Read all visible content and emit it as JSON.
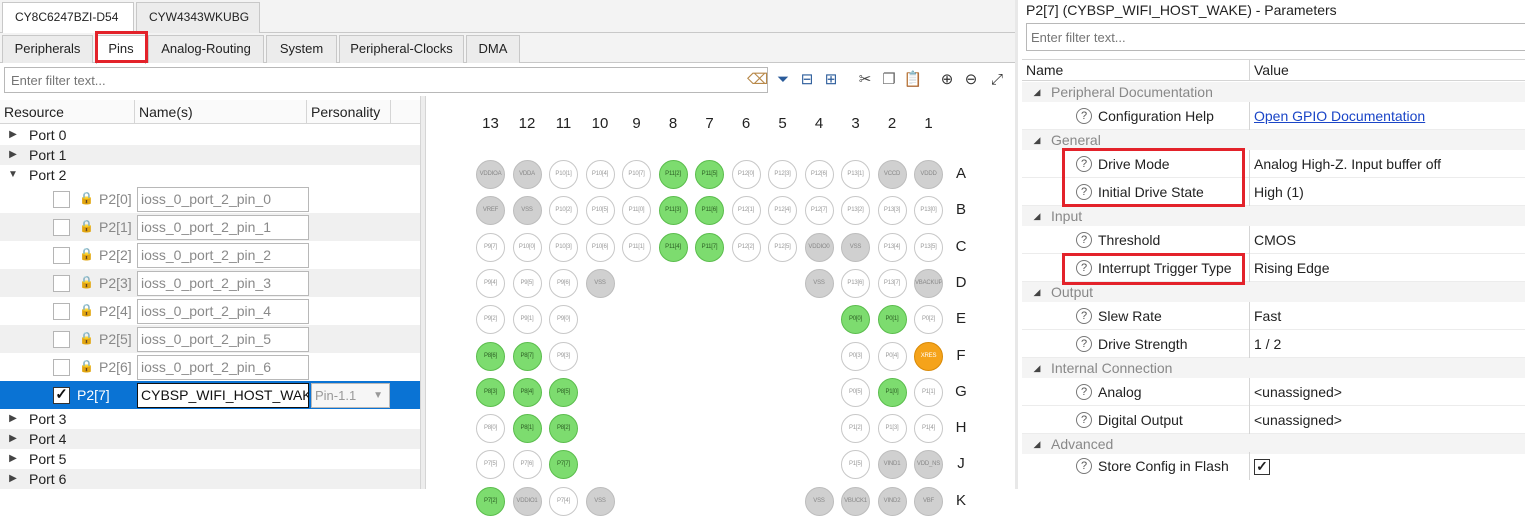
{
  "device_tabs": [
    "CY8C6247BZI-D54",
    "CYW4343WKUBG"
  ],
  "sub_tabs": [
    "Peripherals",
    "Pins",
    "Analog-Routing",
    "System",
    "Peripheral-Clocks",
    "DMA"
  ],
  "filter_placeholder": "Enter filter text...",
  "resource_table": {
    "headers": [
      "Resource",
      "Name(s)",
      "Personality"
    ],
    "ports_top": [
      "Port 0",
      "Port 1",
      "Port 2"
    ],
    "pins": [
      {
        "label": "P2[0]",
        "name": "ioss_0_port_2_pin_0"
      },
      {
        "label": "P2[1]",
        "name": "ioss_0_port_2_pin_1"
      },
      {
        "label": "P2[2]",
        "name": "ioss_0_port_2_pin_2"
      },
      {
        "label": "P2[3]",
        "name": "ioss_0_port_2_pin_3"
      },
      {
        "label": "P2[4]",
        "name": "ioss_0_port_2_pin_4"
      },
      {
        "label": "P2[5]",
        "name": "ioss_0_port_2_pin_5"
      },
      {
        "label": "P2[6]",
        "name": "ioss_0_port_2_pin_6"
      },
      {
        "label": "P2[7]",
        "name": "CYBSP_WIFI_HOST_WAKE",
        "personality": "Pin-1.1"
      }
    ],
    "ports_bottom": [
      "Port 3",
      "Port 4",
      "Port 5",
      "Port 6"
    ]
  },
  "pin_grid": {
    "columns": [
      "13",
      "12",
      "11",
      "10",
      "9",
      "8",
      "7",
      "6",
      "5",
      "4",
      "3",
      "2",
      "1"
    ],
    "rows": [
      "A",
      "B",
      "C",
      "D",
      "E",
      "F",
      "G",
      "H",
      "J",
      "K"
    ],
    "pins": [
      [
        "VDDIOA",
        "VDDA",
        "P10[1]",
        "P10[4]",
        "P10[7]",
        "P11[2]",
        "P11[5]",
        "P12[0]",
        "P12[3]",
        "P12[6]",
        "P13[1]",
        "VCCD",
        "VDDD"
      ],
      [
        "VREF",
        "VSS",
        "P10[2]",
        "P10[5]",
        "P11[0]",
        "P11[3]",
        "P11[6]",
        "P12[1]",
        "P12[4]",
        "P12[7]",
        "P13[2]",
        "P13[3]",
        "P13[0]"
      ],
      [
        "P9[7]",
        "P10[0]",
        "P10[3]",
        "P10[6]",
        "P11[1]",
        "P11[4]",
        "P11[7]",
        "P12[2]",
        "P12[5]",
        "VDDIO0",
        "VSS",
        "P13[4]",
        "P13[5]"
      ],
      [
        "P9[4]",
        "P9[5]",
        "P9[6]",
        "VSS",
        "",
        "",
        "",
        "",
        "",
        "VSS",
        "P13[6]",
        "P13[7]",
        "VBACKUP"
      ],
      [
        "P9[2]",
        "P9[1]",
        "P9[0]",
        "",
        "",
        "",
        "",
        "",
        "",
        "",
        "P0[0]",
        "P0[1]",
        "P0[2]"
      ],
      [
        "P8[6]",
        "P8[7]",
        "P9[3]",
        "",
        "",
        "",
        "",
        "",
        "",
        "",
        "P0[3]",
        "P0[4]",
        "XRES"
      ],
      [
        "P8[3]",
        "P8[4]",
        "P8[5]",
        "",
        "",
        "",
        "",
        "",
        "",
        "",
        "P0[5]",
        "P1[0]",
        "P1[1]"
      ],
      [
        "P8[0]",
        "P8[1]",
        "P8[2]",
        "",
        "",
        "",
        "",
        "",
        "",
        "",
        "P1[2]",
        "P1[3]",
        "P1[4]"
      ],
      [
        "P7[5]",
        "P7[6]",
        "P7[7]",
        "",
        "",
        "",
        "",
        "",
        "",
        "",
        "P1[5]",
        "VIND1",
        "VDD_NS"
      ],
      [
        "P7[2]",
        "VDDIO1",
        "P7[4]",
        "VSS",
        "",
        "",
        "",
        "",
        "",
        "VSS",
        "VBUCK1",
        "VIND2",
        "VBF"
      ]
    ],
    "states": [
      [
        "g",
        "g",
        "w",
        "w",
        "w",
        "G",
        "G",
        "w",
        "w",
        "w",
        "w",
        "g",
        "g"
      ],
      [
        "g",
        "g",
        "w",
        "w",
        "w",
        "G",
        "G",
        "w",
        "w",
        "w",
        "w",
        "w",
        "w"
      ],
      [
        "w",
        "w",
        "w",
        "w",
        "w",
        "G",
        "G",
        "w",
        "w",
        "g",
        "g",
        "w",
        "w"
      ],
      [
        "w",
        "w",
        "w",
        "g",
        "-",
        "-",
        "-",
        "-",
        "-",
        "g",
        "w",
        "w",
        "g"
      ],
      [
        "w",
        "w",
        "w",
        "-",
        "-",
        "-",
        "-",
        "-",
        "-",
        "-",
        "G",
        "G",
        "w"
      ],
      [
        "G",
        "G",
        "w",
        "-",
        "-",
        "-",
        "-",
        "-",
        "-",
        "-",
        "w",
        "w",
        "O"
      ],
      [
        "G",
        "G",
        "G",
        "-",
        "-",
        "-",
        "-",
        "-",
        "-",
        "-",
        "w",
        "G",
        "w"
      ],
      [
        "w",
        "G",
        "G",
        "-",
        "-",
        "-",
        "-",
        "-",
        "-",
        "-",
        "w",
        "w",
        "w"
      ],
      [
        "w",
        "w",
        "G",
        "-",
        "-",
        "-",
        "-",
        "-",
        "-",
        "-",
        "w",
        "g",
        "g"
      ],
      [
        "G",
        "g",
        "w",
        "g",
        "-",
        "-",
        "-",
        "-",
        "-",
        "g",
        "g",
        "g",
        "g"
      ]
    ]
  },
  "parameters": {
    "title": "P2[7] (CYBSP_WIFI_HOST_WAKE) - Parameters",
    "filter_placeholder": "Enter filter text...",
    "col_name": "Name",
    "col_value": "Value",
    "groups": {
      "peripheral_doc": "Peripheral Documentation",
      "general": "General",
      "input": "Input",
      "output": "Output",
      "internal": "Internal Connection",
      "advanced": "Advanced"
    },
    "items": {
      "config_help": {
        "name": "Configuration Help",
        "value": "Open GPIO Documentation"
      },
      "drive_mode": {
        "name": "Drive Mode",
        "value": "Analog High-Z. Input buffer off"
      },
      "initial_drive_state": {
        "name": "Initial Drive State",
        "value": "High (1)"
      },
      "threshold": {
        "name": "Threshold",
        "value": "CMOS"
      },
      "interrupt_trigger": {
        "name": "Interrupt Trigger Type",
        "value": "Rising Edge"
      },
      "slew_rate": {
        "name": "Slew Rate",
        "value": "Fast"
      },
      "drive_strength": {
        "name": "Drive Strength",
        "value": "1 / 2"
      },
      "analog": {
        "name": "Analog",
        "value": "<unassigned>"
      },
      "digital_output": {
        "name": "Digital Output",
        "value": "<unassigned>"
      },
      "store_config": {
        "name": "Store Config in Flash",
        "value": "✓"
      }
    }
  },
  "colors": {
    "accent_red": "#e3222a",
    "selection_blue": "#0a73d4",
    "pin_green": "#7ddc6f",
    "pin_orange": "#f5a31a",
    "link_blue": "#1a45c7"
  }
}
